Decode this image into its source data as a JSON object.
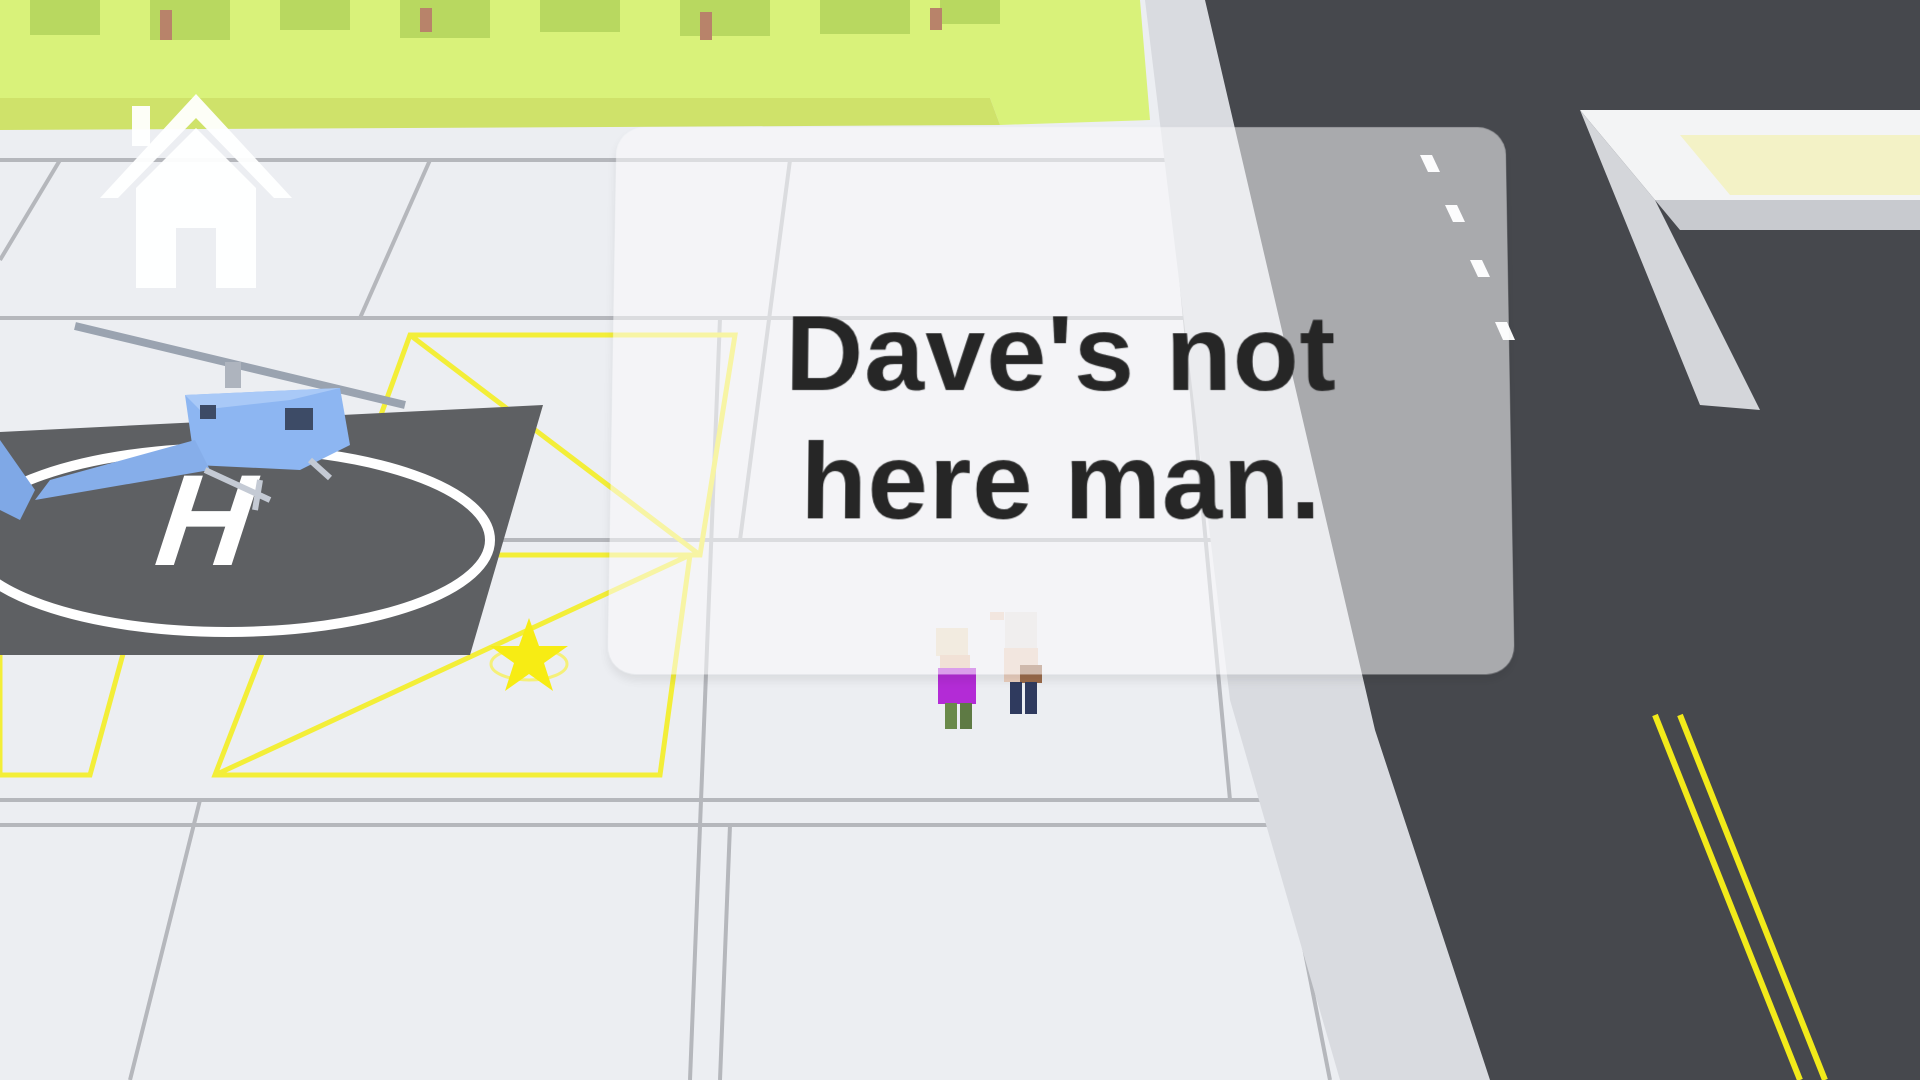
{
  "hud": {
    "home_icon": "home-icon"
  },
  "dialog": {
    "line1": "Dave's not",
    "line2": "here man."
  },
  "scene": {
    "helipad_letter": "H",
    "objective_icon": "star-icon",
    "colors": {
      "ground": "#eaebef",
      "road": "#46484d",
      "road_line": "#f2ea1a",
      "grass": "#d6f06e",
      "helipad": "#5e6063",
      "helicopter": "#8fb8f5",
      "parking_line": "#f5ef3a"
    }
  }
}
